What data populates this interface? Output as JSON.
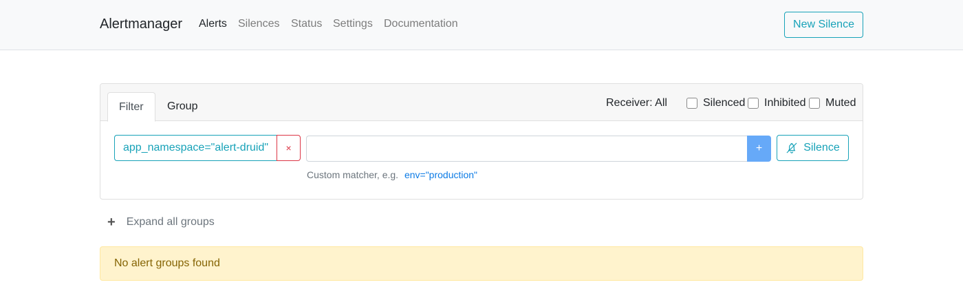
{
  "navbar": {
    "brand": "Alertmanager",
    "links": [
      {
        "label": "Alerts",
        "active": true
      },
      {
        "label": "Silences",
        "active": false
      },
      {
        "label": "Status",
        "active": false
      },
      {
        "label": "Settings",
        "active": false
      },
      {
        "label": "Documentation",
        "active": false
      }
    ],
    "new_silence_label": "New Silence"
  },
  "filter_card": {
    "tabs": [
      {
        "label": "Filter",
        "active": true
      },
      {
        "label": "Group",
        "active": false
      }
    ],
    "receiver_label": "Receiver: All",
    "checkboxes": [
      {
        "label": "Silenced",
        "checked": false
      },
      {
        "label": "Inhibited",
        "checked": false
      },
      {
        "label": "Muted",
        "checked": false
      }
    ],
    "active_matcher": "app_namespace=\"alert-druid\"",
    "remove_matcher_icon": "×",
    "matcher_input_value": "",
    "add_button_label": "+",
    "silence_button_label": "Silence",
    "hint_text": "Custom matcher, e.g.",
    "hint_example": "env=\"production\""
  },
  "expand_all_label": "Expand all groups",
  "expand_icon": "+",
  "empty_message": "No alert groups found",
  "colors": {
    "accent": "#17a2b8",
    "danger": "#dc3545",
    "primary_light": "#66a9f8",
    "warning_bg": "#fff3cd",
    "warning_text": "#856404"
  }
}
